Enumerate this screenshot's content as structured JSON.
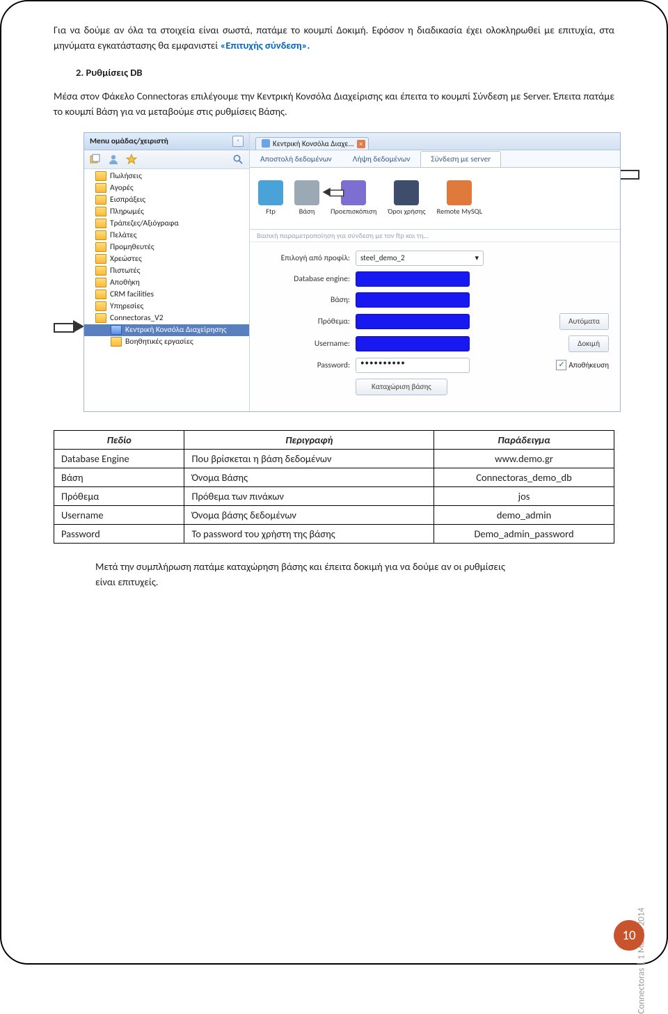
{
  "para1_a": "Για να δούμε αν όλα τα στοιχεία είναι σωστά, πατάμε το κουμπί Δοκιμή. Εφόσον η διαδικασία έχει ολοκληρωθεί με επιτυχία, στα μηνύματα εγκατάστασης θα εμφανιστεί ",
  "para1_success": "«Επιτυχής σύνδεση».",
  "heading": "2. Ρυθμίσεις DB",
  "para2": "Μέσα στον Φάκελο Connectoras επιλέγουμε την Κεντρική Κονσόλα Διαχείρισης και έπειτα το κουμπί Σύνδεση με Server. Έπειτα πατάμε το κουμπί Βάση για να μεταβούμε στις ρυθμίσεις Βάσης.",
  "sidebar": {
    "header": "Menu ομάδας/χειριστή",
    "collapse": "‹",
    "items": [
      {
        "label": "Πωλήσεις"
      },
      {
        "label": "Αγορές"
      },
      {
        "label": "Εισπράξεις"
      },
      {
        "label": "Πληρωμές"
      },
      {
        "label": "Τράπεζες/Αξιόγραφα"
      },
      {
        "label": "Πελάτες"
      },
      {
        "label": "Προμηθευτές"
      },
      {
        "label": "Χρεώστες"
      },
      {
        "label": "Πιστωτές"
      },
      {
        "label": "Αποθήκη"
      },
      {
        "label": "CRM facilities"
      },
      {
        "label": "Υπηρεσίες"
      },
      {
        "label": "Connectoras_V2"
      },
      {
        "label": "Κεντρική Κονσόλα Διαχείρησης",
        "selected": true,
        "sub": true
      },
      {
        "label": "Βοηθητικές εργασίες",
        "sub": true
      }
    ]
  },
  "main": {
    "doctab": "Κεντρική Κονσόλα Διαχε...",
    "ribbon_tabs": [
      "Αποστολή δεδομένων",
      "Λήψη δεδομένων",
      "Σύνδεση με server"
    ],
    "ribbon_active": 2,
    "ribbon_buttons": [
      {
        "label": "Ftp",
        "color": "#4aa3d8"
      },
      {
        "label": "Βάση",
        "color": "#7a8fa3"
      },
      {
        "label": "Προεπισκόπιση",
        "color": "#7d6fd1"
      },
      {
        "label": "Όροι χρήσης",
        "color": "#3d4d6b"
      },
      {
        "label": "Remote MySQL",
        "color": "#e07a3c"
      }
    ],
    "subcap": "Βασική παραμετροποίηση για σύνδεση με τον ftp και τη…",
    "form": {
      "profile_label": "Επιλογή από προφίλ:",
      "profile_value": "steel_demo_2",
      "engine_label": "Database engine:",
      "base_label": "Βάση:",
      "prefix_label": "Πρόθεμα:",
      "username_label": "Username:",
      "password_label": "Password:",
      "password_value": "••••••••••",
      "btn_auto": "Αυτόματα",
      "btn_test": "Δοκιμή",
      "chk_save": "Αποθήκευση",
      "btn_register": "Καταχώριση βάσης"
    }
  },
  "table": {
    "headers": [
      "Πεδίο",
      "Περιγραφή",
      "Παράδειγμα"
    ],
    "rows": [
      [
        "Database Engine",
        "Που βρίσκεται η βάση δεδομένων",
        "www.demo.gr"
      ],
      [
        "Βάση",
        "Όνομα Βάσης",
        "Connectoras_demo_db"
      ],
      [
        "Πρόθεμα",
        "Πρόθεμα των πινάκων",
        "jos"
      ],
      [
        "Username",
        "Όνομα βάσης δεδομένων",
        "demo_admin"
      ],
      [
        "Password",
        "Το password του χρήστη της βάσης",
        "Demo_admin_password"
      ]
    ]
  },
  "after": "Μετά την συμπλήρωση πατάμε καταχώρηση βάσης και έπειτα δοκιμή για να δούμε αν οι ρυθμίσεις είναι επιτυχείς.",
  "footer": "Connectoras | 1 Μαΐου 2014",
  "page_number": "10"
}
